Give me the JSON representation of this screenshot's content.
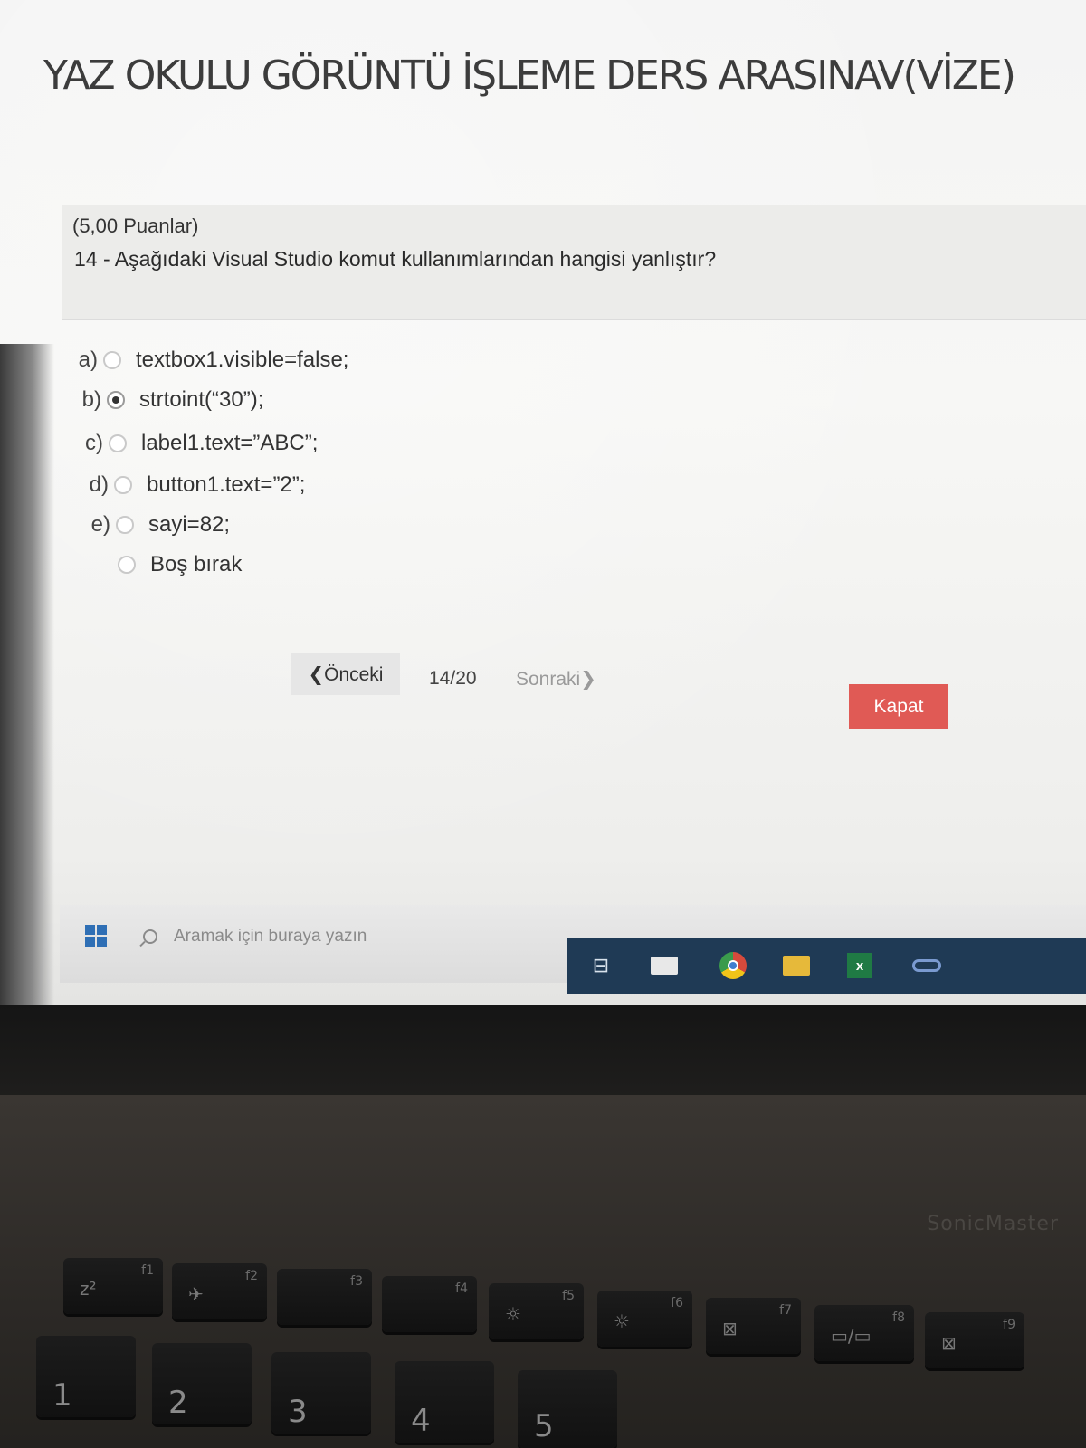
{
  "exam": {
    "title": "YAZ OKULU GÖRÜNTÜ İŞLEME DERS ARASINAV(VİZE)"
  },
  "question": {
    "points": "(5,00 Puanlar)",
    "text": "14 -  Aşağıdaki Visual Studio komut kullanımlarından hangisi yanlıştır?",
    "options": [
      {
        "letter": "a)",
        "text": "textbox1.visible=false;",
        "selected": false
      },
      {
        "letter": "b)",
        "text": "strtoint(“30”);",
        "selected": true
      },
      {
        "letter": "c)",
        "text": "label1.text=”ABC”;",
        "selected": false
      },
      {
        "letter": "d)",
        "text": "button1.text=”2”;",
        "selected": false
      },
      {
        "letter": "e)",
        "text": "sayi=82;",
        "selected": false
      },
      {
        "letter": "",
        "text": "Boş bırak",
        "selected": false
      }
    ]
  },
  "navigation": {
    "prev_label": "❮Önceki",
    "page": "14/20",
    "next_label": "Sonraki❯",
    "close_label": "Kapat"
  },
  "colors": {
    "close_button": "#e05a55",
    "taskbar_tray": "#1f3a55",
    "windows_logo": "#2f6fb5"
  },
  "taskbar": {
    "search_placeholder": "Aramak için buraya yazın",
    "icons": [
      "windows-start-icon",
      "search-icon",
      "task-view-icon",
      "mail-icon",
      "chrome-icon",
      "file-explorer-icon",
      "excel-icon",
      "infinity-icon"
    ]
  },
  "laptop": {
    "brand_text": "SonicMaster",
    "keys": [
      {
        "fn": "f1",
        "symbol": "z²"
      },
      {
        "fn": "f2",
        "symbol": "✈"
      },
      {
        "fn": "f3",
        "symbol": ""
      },
      {
        "fn": "f4",
        "symbol": ""
      },
      {
        "fn": "f5",
        "symbol": "☼"
      },
      {
        "fn": "f6",
        "symbol": "☼"
      },
      {
        "fn": "f7",
        "symbol": "⊠"
      },
      {
        "fn": "f8",
        "symbol": "▭/▭"
      },
      {
        "fn": "f9",
        "symbol": "⊠"
      }
    ],
    "number_row": [
      "1",
      "2",
      "3",
      "4",
      "5"
    ]
  }
}
